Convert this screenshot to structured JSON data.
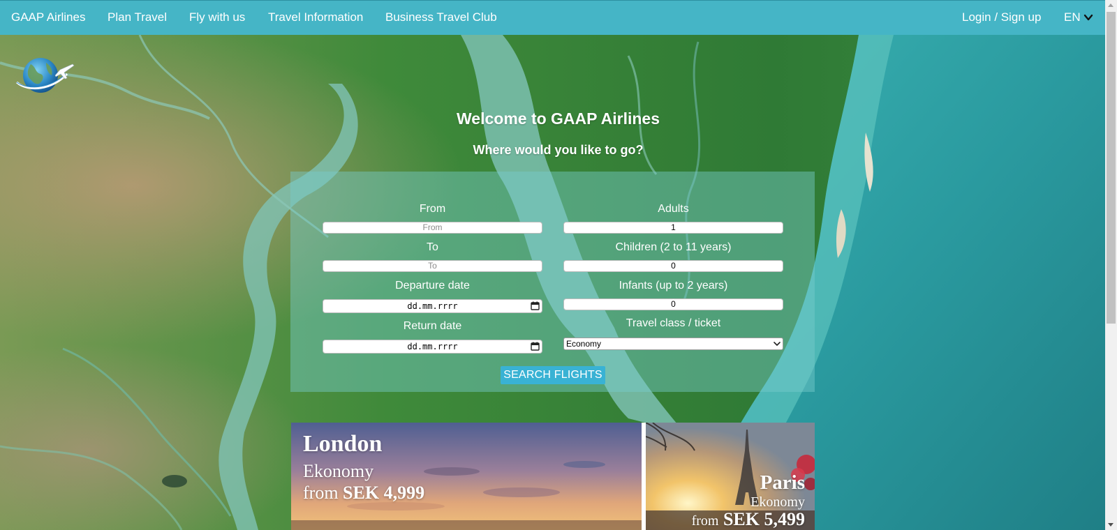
{
  "nav": {
    "brand": "GAAP Airlines",
    "links": [
      "Plan Travel",
      "Fly with us",
      "Travel Information",
      "Business Travel Club"
    ],
    "login": "Login / Sign up",
    "language": "EN",
    "background_color": "#45b5c6"
  },
  "hero": {
    "title": "Welcome to GAAP Airlines",
    "subtitle": "Where would you like to go?"
  },
  "search": {
    "from_label": "From",
    "from_placeholder": "From",
    "to_label": "To",
    "to_placeholder": "To",
    "departure_label": "Departure date",
    "departure_value": "dd.mm.rrrr",
    "return_label": "Return date",
    "return_value": "dd.mm.rrrr",
    "adults_label": "Adults",
    "adults_value": "1",
    "children_label": "Children (2 to 11 years)",
    "children_value": "0",
    "infants_label": "Infants (up to 2 years)",
    "infants_value": "0",
    "class_label": "Travel class / ticket",
    "class_value": "Economy",
    "button": "SEARCH FLIGHTS",
    "button_color": "#39b2d4"
  },
  "deals": [
    {
      "city": "London",
      "class": "Ekonomy",
      "price_prefix": "from",
      "price": "SEK 4,999"
    },
    {
      "city": "Paris",
      "class": "Ekonomy",
      "price_prefix": "from",
      "price": "SEK 5,499"
    }
  ],
  "icons": {
    "logo": "globe-airplane-logo",
    "language_toggle": "chevron-down-icon",
    "date_picker": "calendar-icon",
    "select_arrow": "chevron-down-icon"
  }
}
